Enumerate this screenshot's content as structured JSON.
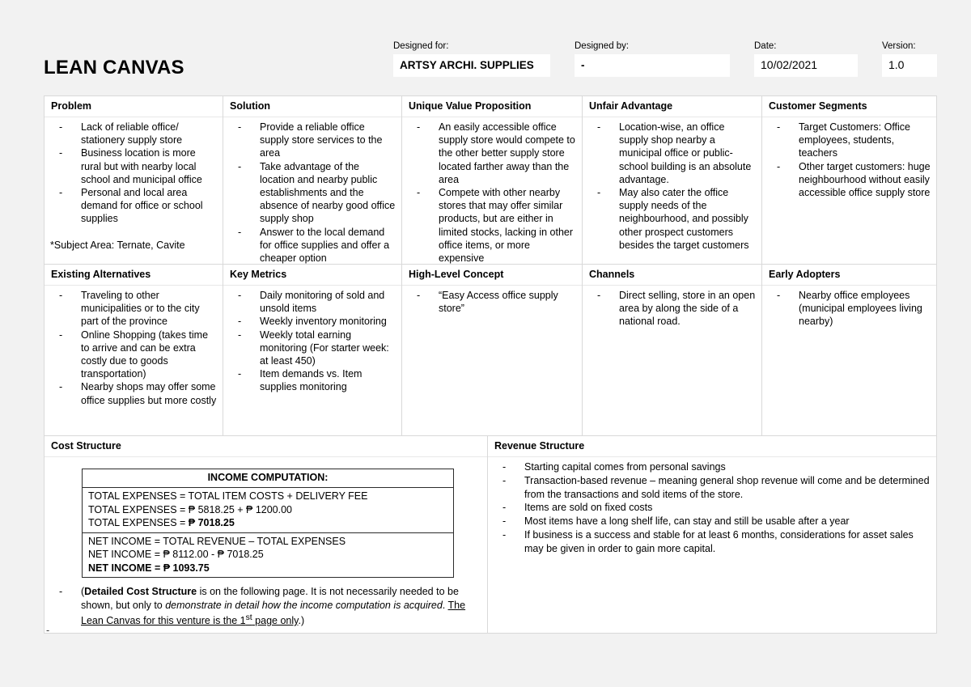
{
  "header": {
    "title": "LEAN CANVAS",
    "fields": [
      {
        "label": "Designed for:",
        "value": "ARTSY ARCHI. SUPPLIES"
      },
      {
        "label": "Designed by:",
        "value": "-"
      },
      {
        "label": "Date:",
        "value": "10/02/2021"
      },
      {
        "label": "Version:",
        "value": "1.0"
      }
    ]
  },
  "canvas": {
    "problem": {
      "title": "Problem",
      "items": [
        "Lack of reliable office/ stationery supply store",
        "Business location is more rural but with nearby local school and municipal office",
        "Personal and local area demand for office or school supplies"
      ],
      "note": "*Subject Area: Ternate, Cavite"
    },
    "solution": {
      "title": "Solution",
      "items": [
        "Provide a reliable office supply store services to the area",
        "Take advantage of the location and nearby public establishments and the absence of nearby good office supply shop",
        "Answer to the local demand for office supplies and offer a cheaper option"
      ]
    },
    "uvp": {
      "title": "Unique Value Proposition",
      "items": [
        "An easily accessible office supply store would compete to the other better supply store located farther away than the area",
        "Compete with other nearby stores that may offer similar products, but are either in limited stocks, lacking in other office items, or more expensive"
      ]
    },
    "unfair_advantage": {
      "title": "Unfair Advantage",
      "items": [
        "Location-wise, an office supply shop nearby a municipal office or public-school building is an absolute advantage.",
        "May also cater the office supply needs of the neighbourhood, and possibly other prospect customers besides the target customers"
      ]
    },
    "customer_segments": {
      "title": "Customer Segments",
      "items": [
        "Target Customers: Office employees, students, teachers",
        "Other target customers: huge neighbourhood without easily accessible office supply store"
      ]
    },
    "existing_alternatives": {
      "title": "Existing Alternatives",
      "items": [
        "Traveling to other municipalities or to the city part of the province",
        "Online Shopping (takes time to arrive and can be extra costly due to goods transportation)",
        "Nearby shops may offer some office supplies but more costly"
      ]
    },
    "key_metrics": {
      "title": "Key Metrics",
      "items": [
        "Daily monitoring of sold and unsold items",
        "Weekly inventory monitoring",
        "Weekly total earning monitoring (For starter week: at least 450)",
        "Item demands vs. Item supplies monitoring"
      ]
    },
    "high_level_concept": {
      "title": "High-Level Concept",
      "items": [
        "“Easy Access office supply store”"
      ]
    },
    "channels": {
      "title": "Channels",
      "items": [
        "Direct selling, store in an open area by along the side of a national road."
      ]
    },
    "early_adopters": {
      "title": "Early Adopters",
      "items": [
        "Nearby office employees (municipal employees living nearby)"
      ]
    },
    "cost_structure": {
      "title": "Cost Structure",
      "income_box": {
        "heading": "INCOME COMPUTATION:",
        "expenses": [
          "TOTAL EXPENSES = TOTAL ITEM COSTS + DELIVERY FEE",
          "TOTAL EXPENSES = ₱ 5818.25 + ₱ 1200.00",
          "TOTAL EXPENSES = ₱ 7018.25"
        ],
        "net_income": [
          "NET INCOME = TOTAL REVENUE – TOTAL EXPENSES",
          "NET INCOME = ₱ 8112.00 - ₱ 7018.25",
          "NET INCOME = ₱ 1093.75"
        ]
      },
      "note": {
        "open_paren": "(",
        "bold_lead": "Detailed Cost Structure",
        "plain_1": " is on the following page. It is not necessarily needed to be shown, but only to ",
        "italic_1": "demonstrate in detail how the income computation is acquired",
        "plain_2": ". ",
        "underline_1": "The Lean Canvas for this venture is the 1",
        "underline_sup": "st",
        "underline_2": " page only",
        "close": ".)"
      }
    },
    "revenue_structure": {
      "title": "Revenue Structure",
      "items": [
        "Starting capital comes from personal savings",
        "Transaction-based revenue – meaning general shop revenue will come and be determined from the transactions and sold items of the store.",
        "Items are sold on fixed costs",
        "Most items have a long shelf life, can stay and still be usable after a year",
        "If business is a success and stable for at least 6 months, considerations for asset sales may be given in order to gain more capital."
      ]
    }
  },
  "footer": {
    "trailing_dash": "-"
  },
  "colors": {
    "page_background": "#f2f2f2",
    "cell_background": "#ffffff",
    "grid_line": "#d9d9d9",
    "box_border": "#2b2b2b",
    "text": "#000000"
  }
}
